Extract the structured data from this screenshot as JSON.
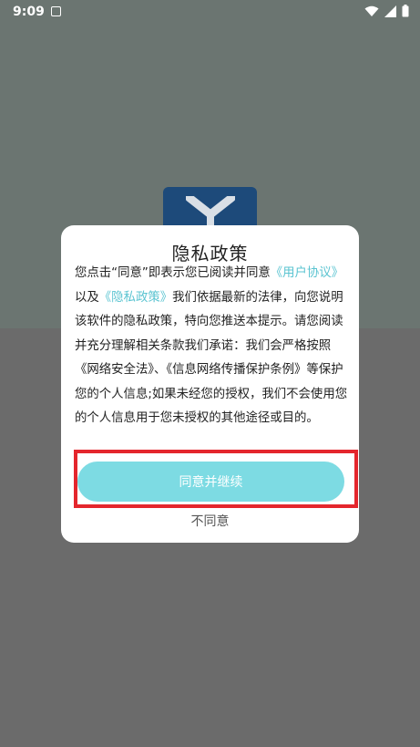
{
  "status_bar": {
    "time": "9:09"
  },
  "dialog": {
    "title": "隐私政策",
    "body_parts": [
      "您点击“同意”即表示您已阅读并同意",
      "《用户协议》",
      "以及",
      "《隐私政策》",
      "我们依据最新的法律，向您说明该软件的隐私政策，特向您推送本提示。请您阅读并充分理解相关条款我们承诺：我们会严格按照《网络安全法》、《信息网络传播保护条例》等保护您的个人信息;如果未经您的授权，我们不会使用您的个人信息用于您未授权的其他途径或目的。"
    ],
    "agree_label": "同意并继续",
    "disagree_label": "不同意"
  },
  "colors": {
    "link": "#5bc4d1",
    "agree_button": "#7ddbe3",
    "highlight_border": "#e4262d",
    "overlay_top": "#6b7571",
    "overlay_bottom": "#6b6b6b"
  }
}
